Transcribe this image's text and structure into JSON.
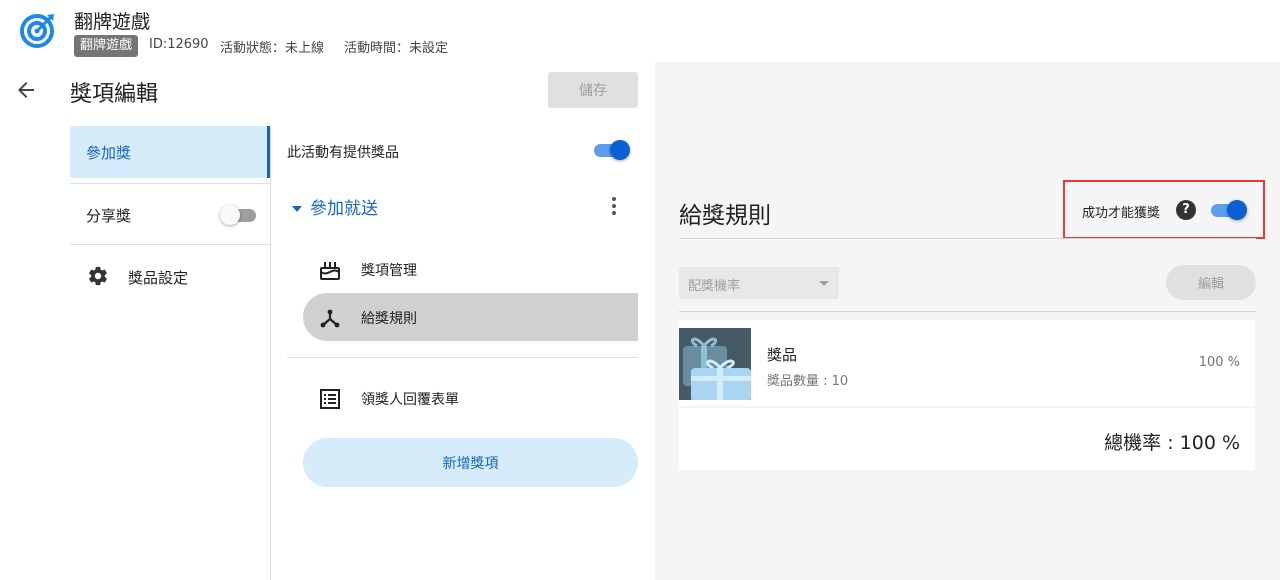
{
  "header": {
    "title": "翻牌遊戲",
    "tag": "翻牌遊戲",
    "id_text": "ID:12690",
    "status_text": "活動狀態：未上線",
    "time_text": "活動時間：未設定",
    "logo_icon": "target-icon",
    "logo_color": "#1e88e5"
  },
  "page": {
    "title": "獎項編輯",
    "save_label": "儲存",
    "back_icon": "arrow-left-icon"
  },
  "nav": {
    "items": [
      {
        "label": "參加獎",
        "active": true
      },
      {
        "label": "分享獎",
        "toggle": "off"
      },
      {
        "label": "獎品設定",
        "icon": "gear-icon"
      }
    ]
  },
  "middle": {
    "provide_label": "此活動有提供獎品",
    "provide_toggle": "on",
    "group_label": "參加就送",
    "sub_items": [
      {
        "label": "獎項管理",
        "icon": "cake-icon"
      },
      {
        "label": "給獎規則",
        "icon": "fork-icon",
        "selected": true
      },
      {
        "label": "領獎人回覆表單",
        "icon": "list-icon"
      }
    ],
    "add_label": "新增獎項"
  },
  "rule": {
    "title": "給獎規則",
    "success_label": "成功才能獲獎",
    "success_toggle": "on",
    "select_value": "配獎機率",
    "edit_label": "編輯",
    "prize": {
      "name": "獎品",
      "qty_text": "獎品數量 : 10",
      "rate_text": "100 %"
    },
    "total_text": "總機率 : 100 %"
  },
  "colors": {
    "accent": "#1565c0",
    "active_bg": "#d6ecfb",
    "toggle_on": "#0d5fd4",
    "highlight": "#e53935"
  }
}
